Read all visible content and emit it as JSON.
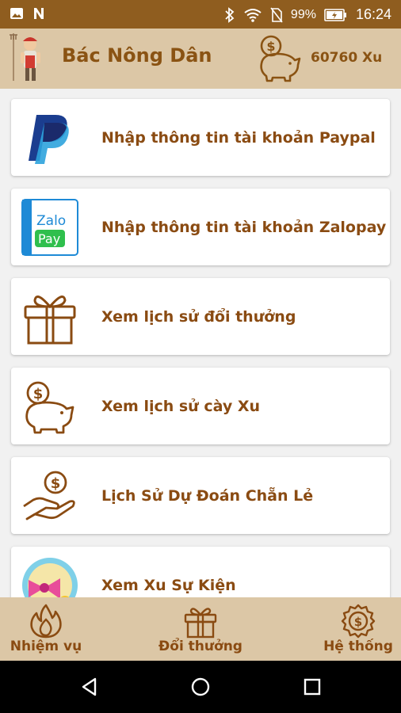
{
  "status_bar": {
    "battery": "99%",
    "time": "16:24"
  },
  "header": {
    "title": "Bác Nông Dân",
    "coins": "60760 Xu"
  },
  "menu": {
    "items": [
      {
        "label": "Nhập thông tin tài khoản Paypal",
        "icon": "paypal-icon"
      },
      {
        "label": "Nhập thông tin tài khoản Zalopay",
        "icon": "zalopay-icon",
        "logo_text_top": "Zalo",
        "logo_text_bottom": "Pay"
      },
      {
        "label": "Xem lịch sử đổi thưởng",
        "icon": "gift-icon"
      },
      {
        "label": "Xem lịch sử cày Xu",
        "icon": "piggy-bank-icon"
      },
      {
        "label": "Lịch Sử Dự Đoán Chẵn Lẻ",
        "icon": "coin-hand-icon"
      },
      {
        "label": "Xem Xu Sự Kiện",
        "icon": "event-icon"
      }
    ]
  },
  "bottom_nav": {
    "items": [
      {
        "label": "Nhiệm vụ",
        "icon": "fire-icon"
      },
      {
        "label": "Đổi thưởng",
        "icon": "gift-icon"
      },
      {
        "label": "Hệ thống",
        "icon": "settings-coin-icon"
      }
    ]
  },
  "colors": {
    "status_bar": "#8f5d1f",
    "app_bar": "#dcc7a6",
    "accent_text": "#8a4b12",
    "background": "#f1f1f1"
  }
}
